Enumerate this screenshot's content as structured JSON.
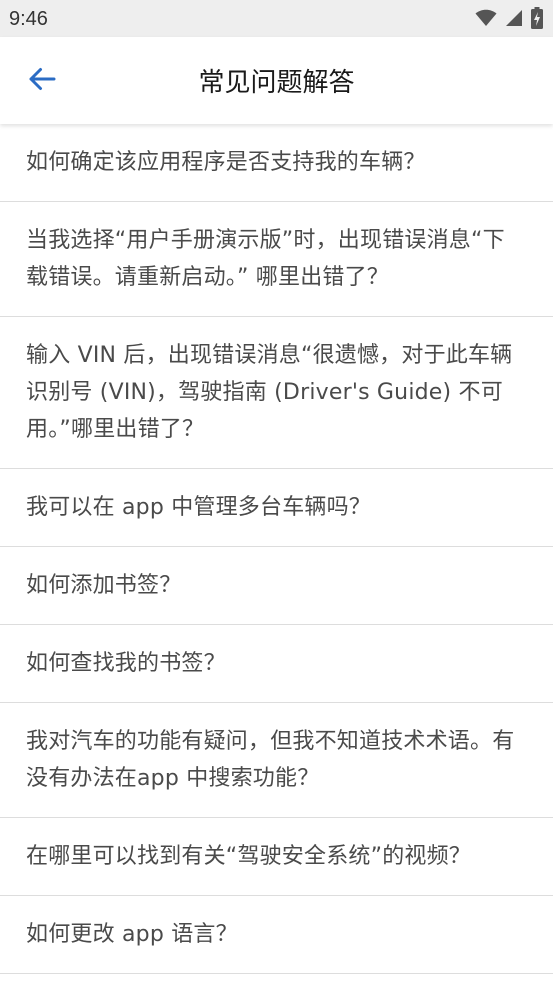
{
  "status_bar": {
    "time": "9:46",
    "icons": [
      "wifi-icon",
      "signal-icon",
      "battery-charging-icon"
    ]
  },
  "header": {
    "title": "常见问题解答",
    "back_icon": "arrow-back-icon",
    "accent_color": "#2b6cc4"
  },
  "faq": {
    "items": [
      {
        "question": "如何确定该应用程序是否支持我的车辆？"
      },
      {
        "question": "当我选择“用户手册演示版”时，出现错误消息“下载错误。请重新启动。” 哪里出错了？"
      },
      {
        "question": "输入 VIN 后，出现错误消息“很遗憾，对于此车辆识别号 (VIN)，驾驶指南 (Driver's Guide) 不可用。”哪里出错了？"
      },
      {
        "question": "我可以在 app 中管理多台车辆吗？"
      },
      {
        "question": "如何添加书签？"
      },
      {
        "question": "如何查找我的书签？"
      },
      {
        "question": "我对汽车的功能有疑问，但我不知道技术术语。有没有办法在app 中搜索功能？"
      },
      {
        "question": "在哪里可以找到有关“驾驶安全系统”的视频？"
      },
      {
        "question": "如何更改 app 语言？"
      }
    ]
  }
}
